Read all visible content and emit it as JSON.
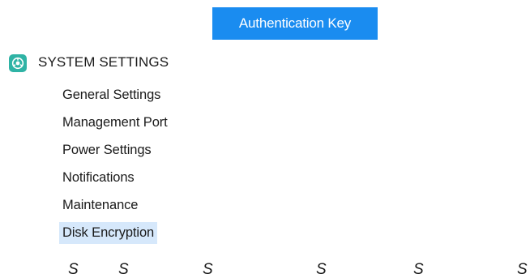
{
  "auth_button": {
    "label": "Authentication Key"
  },
  "section": {
    "icon": "system-gauge-icon",
    "icon_color": "#2fb3a5",
    "title": "SYSTEM SETTINGS"
  },
  "menu": {
    "items": [
      {
        "label": "General Settings"
      },
      {
        "label": "Management Port"
      },
      {
        "label": "Power Settings"
      },
      {
        "label": "Notifications"
      },
      {
        "label": "Maintenance"
      },
      {
        "label": "Disk Encryption",
        "selected": true
      }
    ]
  },
  "bottom_row": {
    "glyphs": [
      "S",
      "S",
      "S",
      "S",
      "S",
      "S"
    ]
  },
  "colors": {
    "accent": "#1a8cf0",
    "selection": "#d6e8fb"
  }
}
